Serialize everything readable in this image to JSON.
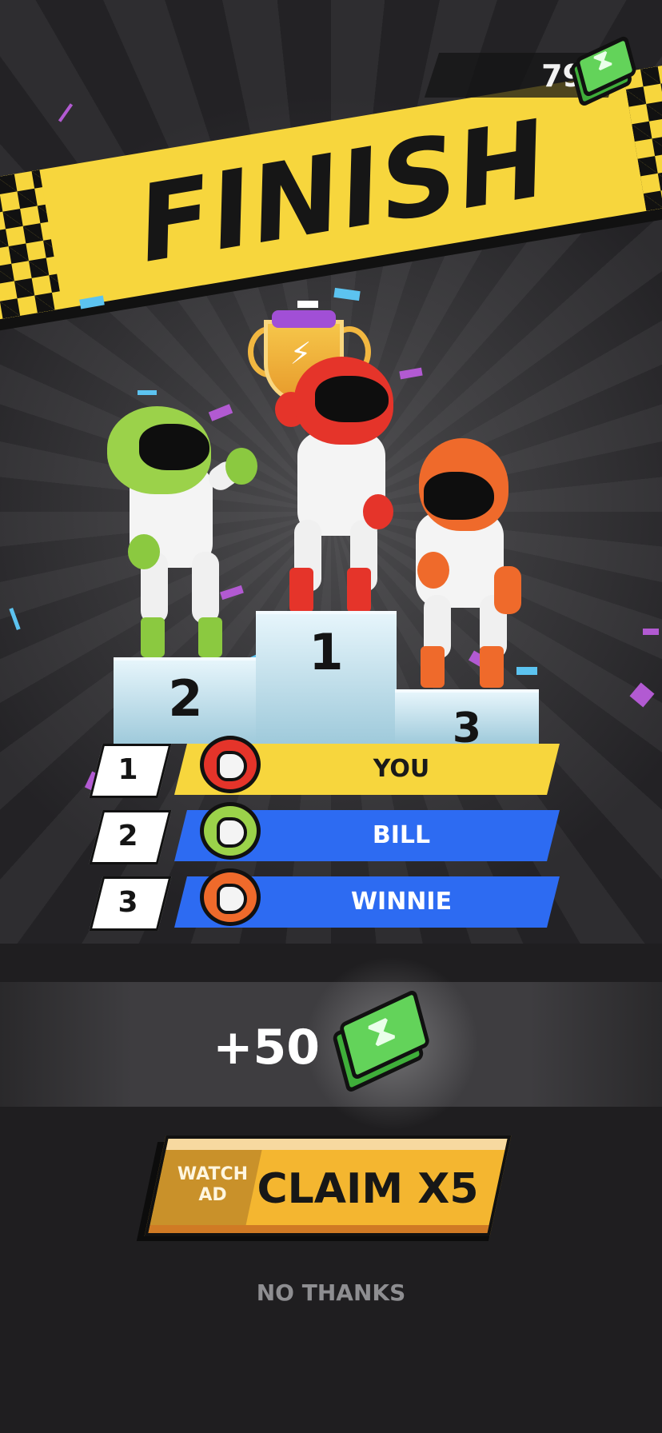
{
  "header": {
    "currency_amount": "79",
    "currency_icon": "cash-icon"
  },
  "banner": {
    "title": "FINISH"
  },
  "podium": {
    "first": "1",
    "second": "2",
    "third": "3"
  },
  "ranking": [
    {
      "rank": "1",
      "name": "YOU",
      "helmet_color": "#e5342a",
      "bar_color": "#f7d63d"
    },
    {
      "rank": "2",
      "name": "BILL",
      "helmet_color": "#9bd24a",
      "bar_color": "#2d6bf2"
    },
    {
      "rank": "3",
      "name": "WINNIE",
      "helmet_color": "#ef6a2b",
      "bar_color": "#2d6bf2"
    }
  ],
  "reward": {
    "amount": "+50",
    "icon": "cash-icon"
  },
  "actions": {
    "watch_ad_label": "WATCH AD",
    "claim_label": "CLAIM X5",
    "no_thanks_label": "NO THANKS"
  },
  "colors": {
    "banner_yellow": "#f7d63d",
    "bar_blue": "#2d6bf2",
    "claim_orange": "#f4b630",
    "cash_green": "#3fae3a"
  }
}
